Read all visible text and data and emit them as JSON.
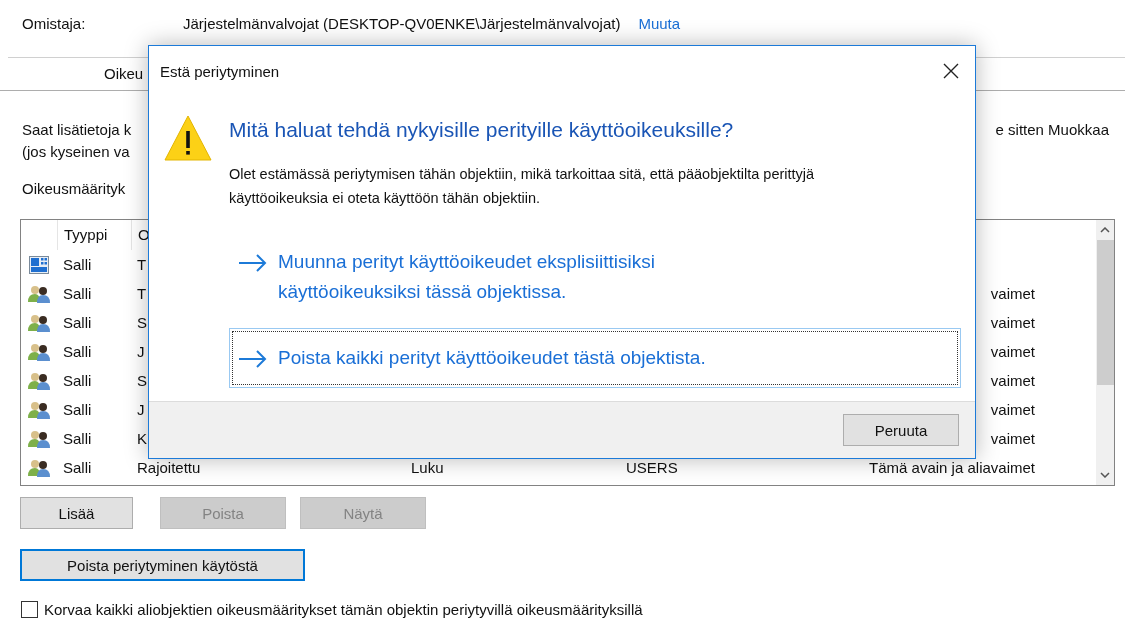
{
  "owner": {
    "label": "Omistaja:",
    "value": "Järjestelmänvalvojat (DESKTOP-QV0ENKE\\Järjestelmänvalvojat)",
    "link": "Muuta"
  },
  "tab": {
    "label": "Oikeu"
  },
  "info": {
    "lines": [
      "Saat lisätietoja k",
      "(jos kyseinen va"
    ],
    "tail": "e sitten Muokkaa"
  },
  "entries_label": "Oikeusmäärityk",
  "table": {
    "columns": [
      "Tyyppi",
      "O"
    ],
    "rows": [
      {
        "kind": "package",
        "type": "Salli",
        "name": "T",
        "access": "",
        "inherited": "",
        "applies": ""
      },
      {
        "kind": "group",
        "type": "Salli",
        "name": "T",
        "access": "",
        "inherited": "",
        "applies": "vaimet"
      },
      {
        "kind": "group",
        "type": "Salli",
        "name": "S",
        "access": "",
        "inherited": "",
        "applies": "vaimet"
      },
      {
        "kind": "group",
        "type": "Salli",
        "name": "J",
        "access": "",
        "inherited": "",
        "applies": "vaimet"
      },
      {
        "kind": "group",
        "type": "Salli",
        "name": "S",
        "access": "",
        "inherited": "",
        "applies": "vaimet"
      },
      {
        "kind": "group",
        "type": "Salli",
        "name": "J",
        "access": "",
        "inherited": "",
        "applies": "vaimet"
      },
      {
        "kind": "group",
        "type": "Salli",
        "name": "K",
        "access": "",
        "inherited": "",
        "applies": "vaimet"
      },
      {
        "kind": "group",
        "type": "Salli",
        "name": "Rajoitettu",
        "access": "Luku",
        "inherited": "USERS",
        "applies": "Tämä avain ja aliavaimet"
      }
    ]
  },
  "buttons": [
    {
      "label": "Lisää",
      "disabled": false
    },
    {
      "label": "Poista",
      "disabled": true
    },
    {
      "label": "Näytä",
      "disabled": true
    }
  ],
  "disable_inheritance_button": "Poista periytyminen käytöstä",
  "replace_checkbox": {
    "label": "Korvaa kaikki aliobjektien oikeusmääritykset tämän objektin periytyvillä oikeusmäärityksillä",
    "checked": false
  },
  "dialog": {
    "title": "Estä periytyminen",
    "heading": "Mitä haluat tehdä nykyisille perityille käyttöoikeuksille?",
    "description": "Olet estämässä periytymisen tähän objektiin, mikä tarkoittaa sitä, että pääobjektilta perittyjä käyttöoikeuksia ei oteta käyttöön tähän objektiin.",
    "options": [
      {
        "label": "Muunna perityt käyttöoikeudet eksplisiittisiksi käyttöoikeuksiksi tässä objektissa.",
        "focused": false
      },
      {
        "label": "Poista kaikki perityt käyttöoikeudet tästä objektista.",
        "focused": true
      }
    ],
    "cancel": "Peruuta"
  }
}
